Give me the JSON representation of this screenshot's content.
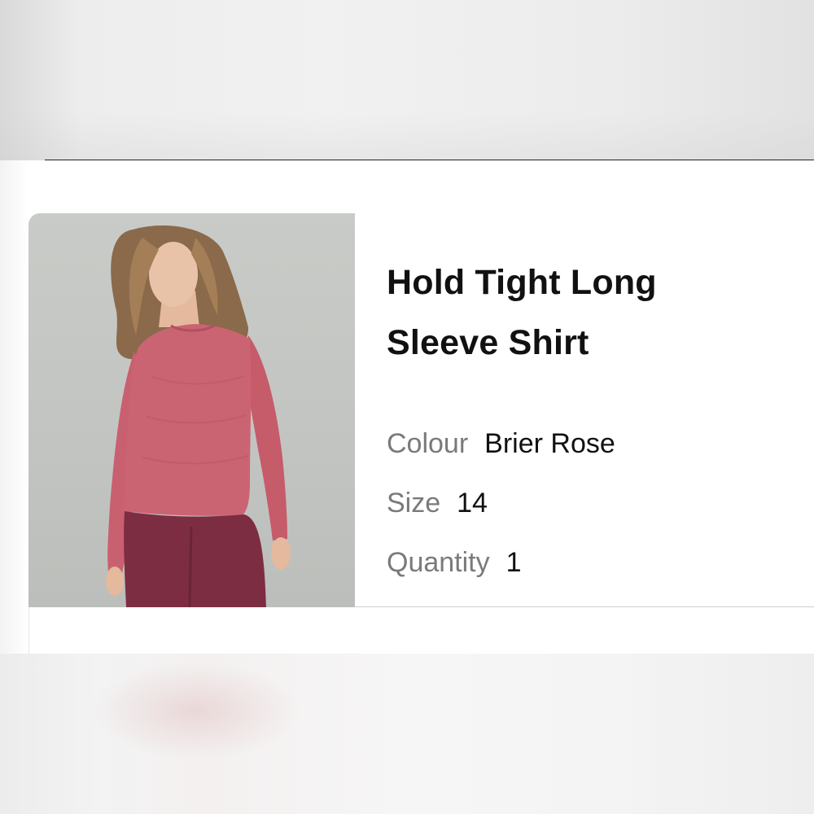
{
  "product": {
    "title": "Hold Tight Long Sleeve Shirt",
    "image_alt": "Woman wearing a pink long sleeve shirt and maroon pants",
    "attributes": {
      "colour_label": "Colour",
      "colour_value": "Brier Rose",
      "size_label": "Size",
      "size_value": "14",
      "quantity_label": "Quantity",
      "quantity_value": "1"
    }
  },
  "colors": {
    "shirt": "#c9606f",
    "pants": "#7d2d42",
    "photo_background": "#c5c7c4",
    "label_grey": "#7a7a7a",
    "text": "#111111"
  }
}
